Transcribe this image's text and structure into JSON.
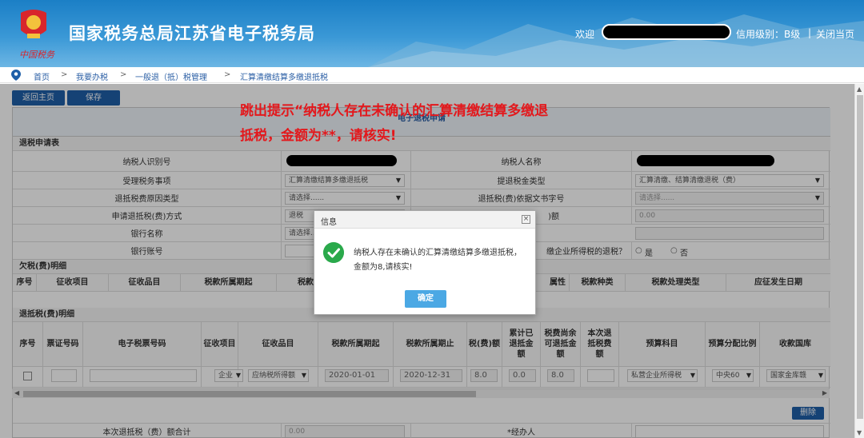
{
  "header": {
    "title": "国家税务总局江苏省电子税务局",
    "slogan": "中国税务",
    "welcome": "欢迎",
    "credit_level": "信用级别：B级",
    "separator": "|",
    "close_home": "关闭当页"
  },
  "breadcrumb": {
    "items": [
      "首页",
      "我要办税",
      "一般退（抵）税管理",
      "汇算清缴结算多缴退抵税"
    ],
    "sep": ">"
  },
  "toolbar": {
    "back_label": "返回主页",
    "save_label": "保存"
  },
  "annotation": {
    "line1": "跳出提示“纳税人存在未确认的汇算清缴结算多缴退",
    "line2": "抵税，金额为**，请核实!"
  },
  "form": {
    "title": "电子退税申请",
    "section_apply": "退税申请表",
    "rows": {
      "taxpayer_id_label": "纳税人识别号",
      "taxpayer_name_label": "纳税人名称",
      "matter_label": "受理税务事项",
      "matter_value": "汇算清缴结算多缴退抵税",
      "refund_type_label": "提退税金类型",
      "refund_type_value": "汇算清缴、结算清缴退税（费）",
      "reason_label": "退抵税费原因类型",
      "reason_value": "请选择......",
      "doc_label": "退抵税(费)依据文书字号",
      "doc_value": "请选择......",
      "method_label": "申请退抵税(费)方式",
      "method_value": "退税",
      "amount_label": ")额",
      "amount_value": "0.00",
      "bank_label": "银行名称",
      "bank_value": "请选择......",
      "account_label": "银行账号",
      "income_tax_label": "缴企业所得税的退税？",
      "yes": "是",
      "no": "否"
    },
    "section_owed": "欠税(费)明细",
    "owed_headers": [
      "序号",
      "征收项目",
      "征收品目",
      "税款所属期起",
      "税款",
      "属性",
      "税款种类",
      "税款处理类型",
      "应征发生日期"
    ],
    "section_refund": "退抵税(费)明细",
    "refund_headers": [
      "序号",
      "票证号码",
      "电子税票号码",
      "征收项目",
      "征收品目",
      "税款所属期起",
      "税款所属期止",
      "税(费)额",
      "累计已退抵金额",
      "税费尚余可退抵金额",
      "本次退抵税费额",
      "预算科目",
      "预算分配比例",
      "收款国库"
    ],
    "refund_row": {
      "levy_item": "企业",
      "levy_sub": "应纳税所得额",
      "period_start": "2020-01-01",
      "period_end": "2020-12-31",
      "tax_amount": "8.0",
      "refunded": "0.0",
      "remaining": "8.0",
      "budget": "私营企业所得税",
      "ratio": "中央60",
      "treasury": "国家金库赣"
    },
    "delete_label": "删除",
    "total_label": "本次退抵税（费）额合计",
    "total_value": "0.00",
    "handler_label": "*经办人"
  },
  "dialog": {
    "title": "信息",
    "close": "×",
    "message": "纳税人存在未确认的汇算清缴结算多缴退抵税，金额为8,请核实!",
    "ok_label": "确定"
  },
  "colors": {
    "brand": "#1f5fa8",
    "alert_red": "#e3181c",
    "success": "#2aa94b"
  }
}
